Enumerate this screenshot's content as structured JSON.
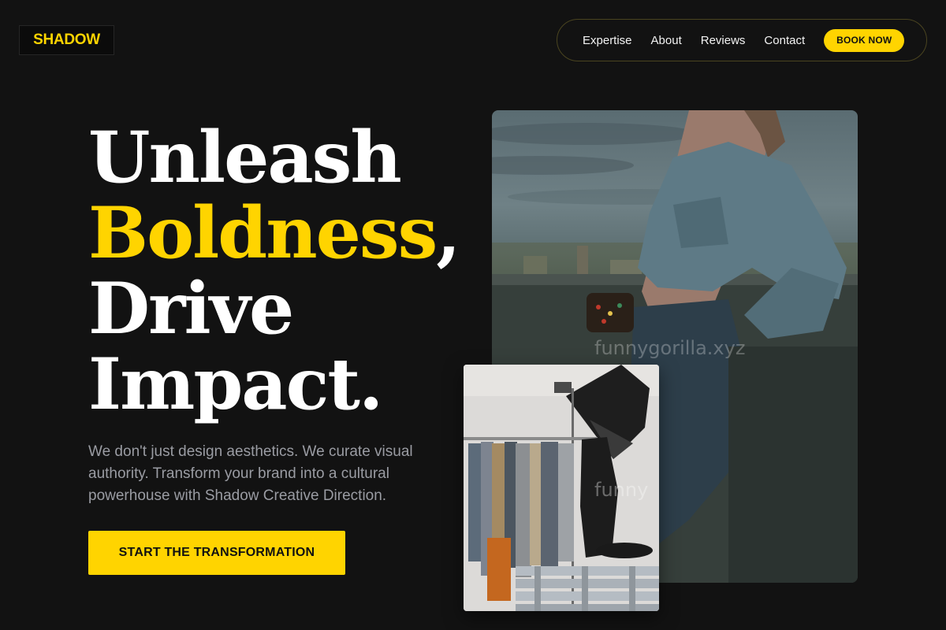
{
  "brand": {
    "name": "SHADOW",
    "accent_color": "#ffd400"
  },
  "nav": {
    "links": [
      "Expertise",
      "About",
      "Reviews",
      "Contact"
    ],
    "book_label": "BOOK NOW"
  },
  "hero": {
    "line1": "Unleash",
    "line2_accent": "Boldness",
    "line2_suffix": ",",
    "line3": "Drive",
    "line4": "Impact.",
    "subtext": "We don't just design aesthetics. We curate visual authority. Transform your brand into a cultural powerhouse with Shadow Creative Direction.",
    "cta_label": "START THE TRANSFORMATION"
  },
  "images": {
    "main_watermark": "funnygorilla.xyz",
    "small_watermark": "funny"
  }
}
